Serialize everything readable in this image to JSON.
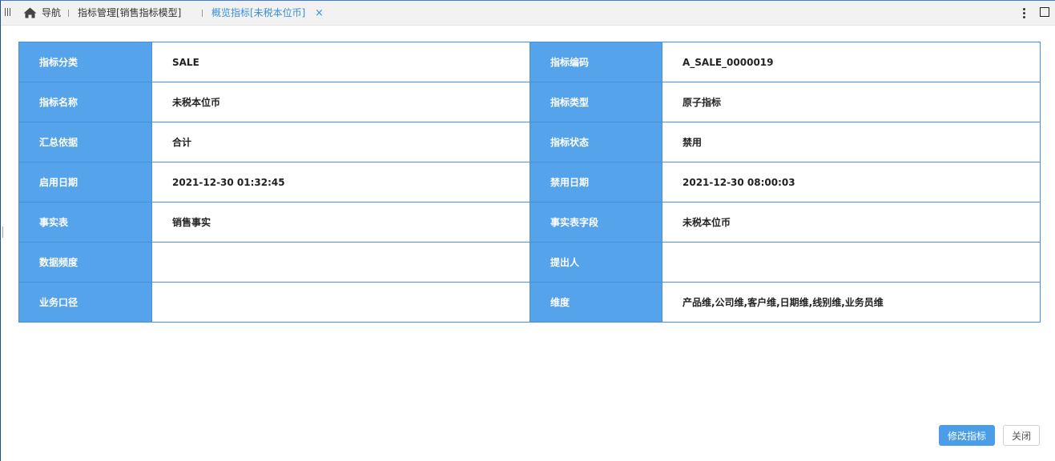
{
  "tabs": {
    "home": "导航",
    "mgmt": "指标管理[销售指标模型]",
    "active": "概览指标[未税本位币]",
    "close_glyph": "×"
  },
  "icons": {
    "grip": "grip-icon",
    "home": "home-icon",
    "more": "more-vertical-icon",
    "maximize": "maximize-icon"
  },
  "colors": {
    "accent": "#55a3ea",
    "active_tab": "#3b8fd9",
    "border": "#4a90d2"
  },
  "rows": [
    {
      "k1": "指标分类",
      "v1": "SALE",
      "k2": "指标编码",
      "v2": "A_SALE_0000019"
    },
    {
      "k1": "指标名称",
      "v1": "未税本位币",
      "k2": "指标类型",
      "v2": "原子指标"
    },
    {
      "k1": "汇总依据",
      "v1": "合计",
      "k2": "指标状态",
      "v2": "禁用"
    },
    {
      "k1": "启用日期",
      "v1": "2021-12-30 01:32:45",
      "k2": "禁用日期",
      "v2": "2021-12-30 08:00:03"
    },
    {
      "k1": "事实表",
      "v1": "销售事实",
      "k2": "事实表字段",
      "v2": "未税本位币"
    },
    {
      "k1": "数据频度",
      "v1": "",
      "k2": "提出人",
      "v2": ""
    },
    {
      "k1": "业务口径",
      "v1": "",
      "k2": "维度",
      "v2": "产品维,公司维,客户维,日期维,线别维,业务员维"
    }
  ],
  "buttons": {
    "modify": "修改指标",
    "close": "关闭"
  }
}
